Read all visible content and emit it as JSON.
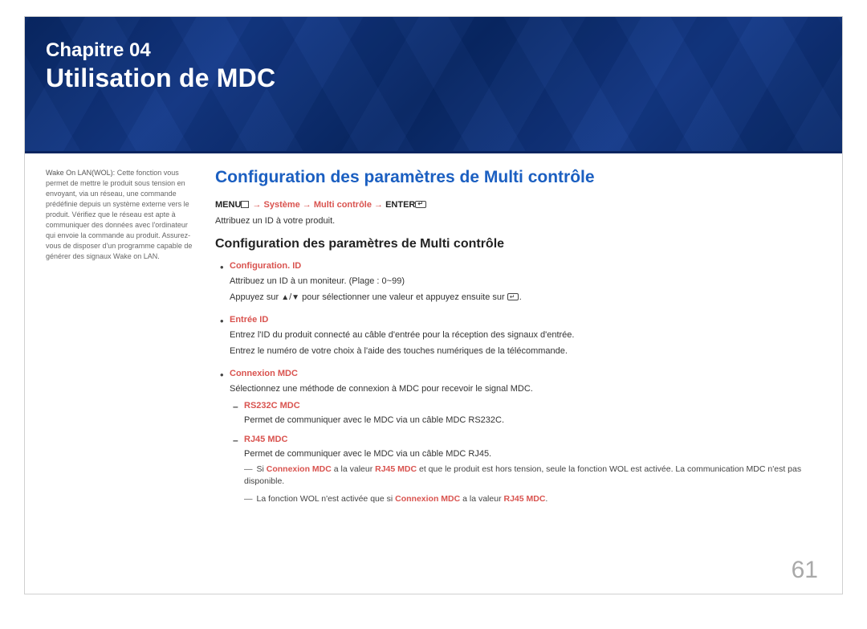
{
  "banner": {
    "chapter_label": "Chapitre 04",
    "chapter_title": "Utilisation de MDC"
  },
  "sidebar": {
    "wol_title": "Wake On LAN(WOL):",
    "wol_body": "Cette fonction vous permet de mettre le produit sous tension en envoyant, via un réseau, une commande prédéfinie depuis un système externe vers le produit. Vérifiez que le réseau est apte à communiquer des données avec l'ordinateur qui envoie la commande au produit. Assurez-vous de disposer d'un programme capable de générer des signaux Wake on LAN."
  },
  "main": {
    "h_blue": "Configuration des paramètres de Multi contrôle",
    "menu_path": {
      "menu": "MENU",
      "mid": " → Système → Multi contrôle → ",
      "enter": "ENTER"
    },
    "assign": "Attribuez un ID à votre produit.",
    "h_black": "Configuration des paramètres de Multi contrôle",
    "items": [
      {
        "title": "Configuration. ID",
        "lines": [
          "Attribuez un ID à un moniteur. (Plage : 0~99)",
          "Appuyez sur ▲/▼ pour sélectionner une valeur et appuyez ensuite sur ↵."
        ]
      },
      {
        "title": "Entrée ID",
        "lines": [
          "Entrez l'ID du produit connecté au câble d'entrée pour la réception des signaux d'entrée.",
          "Entrez le numéro de votre choix à l'aide des touches numériques de la télécommande."
        ]
      },
      {
        "title": "Connexion MDC",
        "lines": [
          "Sélectionnez une méthode de connexion à MDC pour recevoir le signal MDC."
        ],
        "subs": [
          {
            "title": "RS232C MDC",
            "line": "Permet de communiquer avec le MDC via un câble MDC RS232C."
          },
          {
            "title": "RJ45 MDC",
            "line": "Permet de communiquer avec le MDC via un câble MDC RJ45."
          }
        ],
        "notes": [
          {
            "pre": "Si ",
            "r1": "Connexion MDC",
            "mid1": " a la valeur ",
            "r2": "RJ45 MDC",
            "post": " et que le produit est hors tension, seule la fonction WOL est activée. La communication MDC n'est pas disponible."
          },
          {
            "pre": "La fonction WOL n'est activée que si ",
            "r1": "Connexion MDC",
            "mid1": " a la valeur ",
            "r2": "RJ45 MDC",
            "post": "."
          }
        ]
      }
    ]
  },
  "page_number": "61"
}
